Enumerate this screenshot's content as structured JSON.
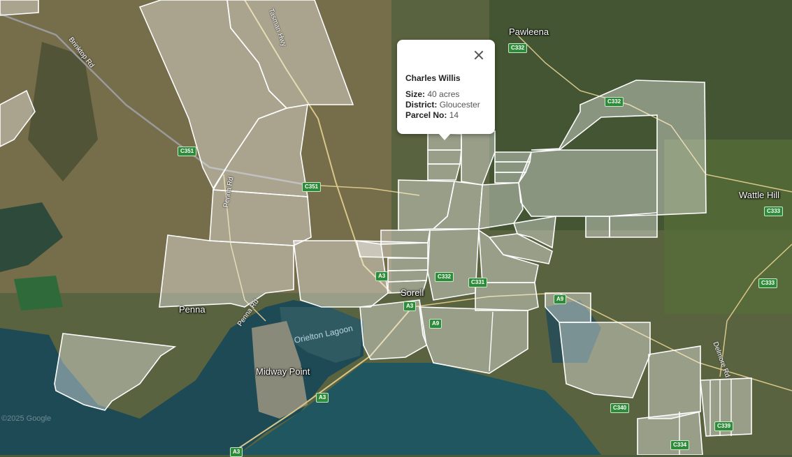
{
  "places": {
    "pawleena": "Pawleena",
    "wattle_hill": "Wattle Hill",
    "sorell": "Sorell",
    "penna": "Penna",
    "midway_point": "Midway Point"
  },
  "water": {
    "orielton_lagoon": "Orielton Lagoon"
  },
  "roads": {
    "brinktop": "Brinktop Rd",
    "tasman_hwy": "Tasman Hwy",
    "penna_rd_north": "Penna Rd",
    "penna_rd_south": "Penna Rd",
    "delmore": "Delmore Rd"
  },
  "shields": {
    "c332_top": "C332",
    "c332_east": "C332",
    "c351_west": "C351",
    "c351_mid": "C351",
    "c333_north": "C333",
    "c333_south": "C333",
    "a3_sorell_n": "A3",
    "a3_sorell_s": "A3",
    "c332_sorell": "C332",
    "c331": "C331",
    "a9_east": "A9",
    "a9_south": "A9",
    "a3_causeway": "A3",
    "a3_bottom": "A3",
    "c340": "C340",
    "c334": "C334",
    "c339": "C339"
  },
  "watermark": "©2025 Google",
  "popup": {
    "name": "Charles Willis",
    "size_label": "Size:",
    "size_value": "40 acres",
    "district_label": "District:",
    "district_value": "Gloucester",
    "parcel_label": "Parcel No:",
    "parcel_value": "14"
  },
  "colors": {
    "parcel_fill": "#ffffff",
    "parcel_stroke": "#ffffff",
    "water": "#1f4a55",
    "land": "#6b6a4a",
    "shield": "#2e8b3a"
  }
}
